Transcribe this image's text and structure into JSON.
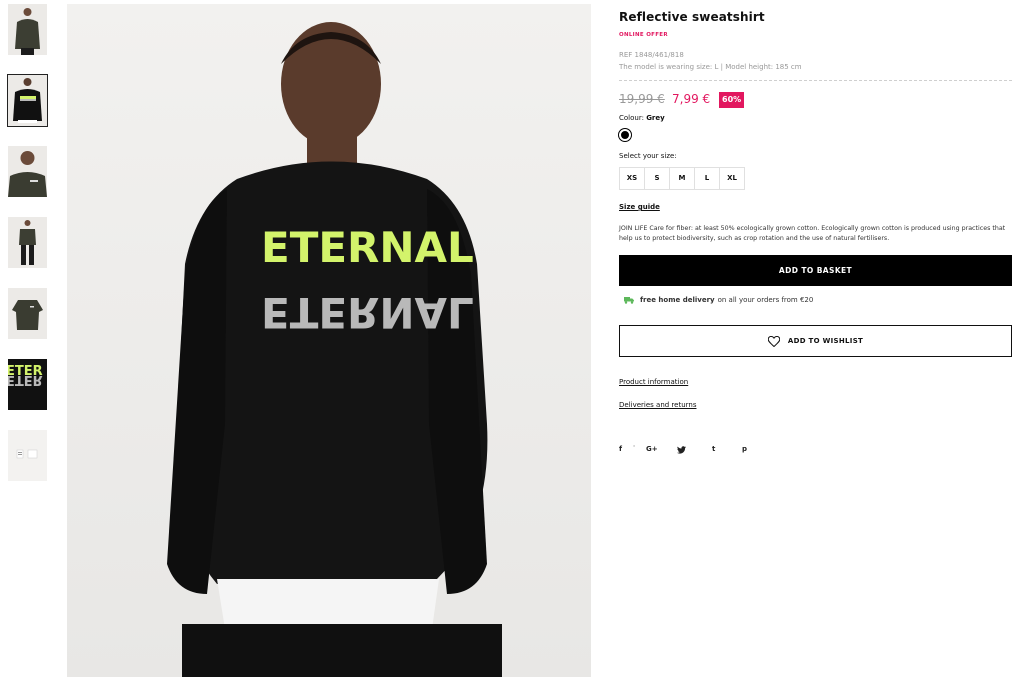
{
  "product": {
    "title": "Reflective sweatshirt",
    "online_offer": "ONLINE OFFER",
    "ref": "REF 1848/461/818",
    "model_info": "The model is wearing size: L | Model height: 185 cm",
    "old_price": "19,99 €",
    "new_price": "7,99 €",
    "discount": "60%",
    "colour_label": "Colour:",
    "colour_value": "Grey",
    "select_size_label": "Select your size:",
    "sizes": [
      "XS",
      "S",
      "M",
      "L",
      "XL"
    ],
    "size_guide": "Size guide",
    "join_life": "JOIN LIFE Care for fiber: at least 50% ecologically grown cotton. Ecologically grown cotton is produced using practices that help us to protect biodiversity, such as crop rotation and the use of natural fertilisers.",
    "add_to_basket": "ADD TO BASKET",
    "delivery_bold": "free home delivery",
    "delivery_rest": "on all your orders from €20",
    "add_to_wishlist": "ADD TO WISHLIST",
    "product_information": "Product information",
    "deliveries_and_returns": "Deliveries and returns"
  },
  "main_image": {
    "print_text": "ETERNAL"
  },
  "social": {
    "facebook": "f",
    "google_plus": "G+",
    "twitter": "twitter-icon",
    "tumblr": "t",
    "pinterest": "p"
  },
  "colors": {
    "accent": "#e2175f",
    "button": "#000000",
    "print_green": "#d3f36b",
    "print_grey": "#b9b9b9",
    "delivery_green": "#5db85b"
  }
}
